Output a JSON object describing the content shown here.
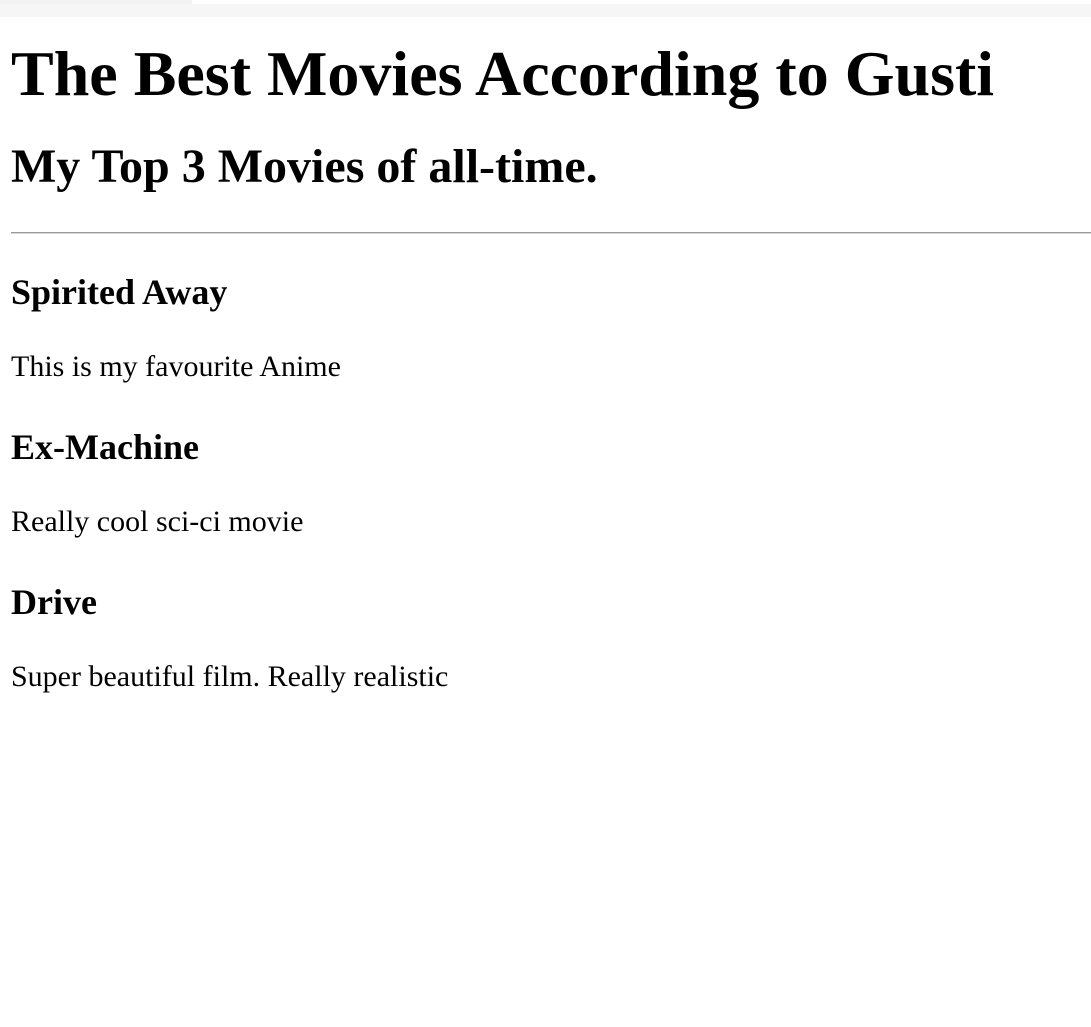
{
  "page": {
    "title": "The Best Movies According to Gusti",
    "subtitle": "My Top 3 Movies of all-time."
  },
  "movies": [
    {
      "title": "Spirited Away",
      "description": "This is my favourite Anime"
    },
    {
      "title": "Ex-Machine",
      "description": "Really cool sci-ci movie"
    },
    {
      "title": "Drive",
      "description": "Super beautiful film. Really realistic"
    }
  ]
}
